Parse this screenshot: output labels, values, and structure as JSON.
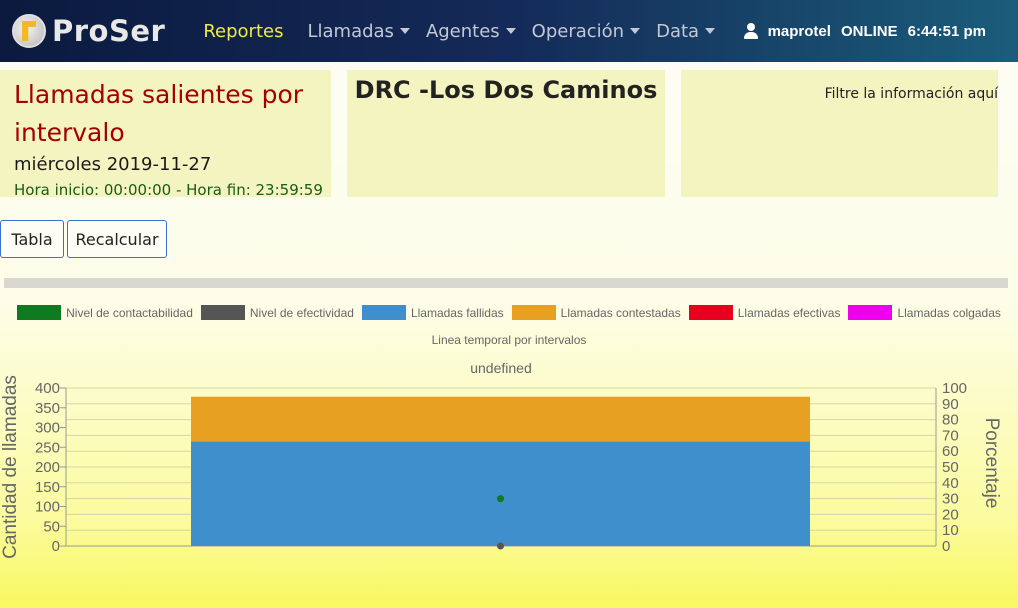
{
  "navbar": {
    "brand": "ProSer",
    "items": [
      {
        "label": "Reportes",
        "active": true,
        "dropdown": false
      },
      {
        "label": "Llamadas",
        "active": false,
        "dropdown": true
      },
      {
        "label": "Agentes",
        "active": false,
        "dropdown": true
      },
      {
        "label": "Operación",
        "active": false,
        "dropdown": true
      },
      {
        "label": "Data",
        "active": false,
        "dropdown": true
      }
    ],
    "user": "maprotel",
    "status": "ONLINE",
    "time": "6:44:51 pm"
  },
  "report": {
    "title": "Llamadas salientes por intervalo",
    "date": "miércoles 2019-11-27",
    "hours": "Hora inicio: 00:00:00 - Hora fin: 23:59:59",
    "site": "DRC -Los Dos Caminos",
    "filter_label": "Filtre la información aquí"
  },
  "buttons": {
    "tabla": "Tabla",
    "recalcular": "Recalcular"
  },
  "colors": {
    "accent_active": "#f1e84a",
    "title_red": "#a40000",
    "card_bg": "#f4f4c0"
  },
  "chart_data": {
    "type": "bar",
    "subtitle": "Linea temporal por intervalos",
    "title": "undefined",
    "legend": [
      {
        "name": "Nivel de contactabilidad",
        "color": "#0f7a1f"
      },
      {
        "name": "Nivel de efectividad",
        "color": "#555555"
      },
      {
        "name": "Llamadas fallidas",
        "color": "#3f8fcc"
      },
      {
        "name": "Llamadas contestadas",
        "color": "#e8a023"
      },
      {
        "name": "Llamadas efectivas",
        "color": "#e8001f"
      },
      {
        "name": "Llamadas colgadas",
        "color": "#ee00ee"
      }
    ],
    "stacked_bars": [
      {
        "name": "Llamadas fallidas",
        "value": 265,
        "color": "#3f8fcc"
      },
      {
        "name": "Llamadas contestadas",
        "value": 113,
        "color": "#e8a023"
      }
    ],
    "points": [
      {
        "name": "Nivel de contactabilidad",
        "value": 30,
        "color": "#0f7a1f"
      },
      {
        "name": "Nivel de efectividad",
        "value": 0,
        "color": "#555555"
      }
    ],
    "ylabel_left": "Cantidad de llamadas",
    "ylabel_right": "Porcentaje",
    "ylim_left": [
      0,
      400
    ],
    "ylim_right": [
      0,
      100
    ],
    "yticks_left": [
      0,
      50,
      100,
      150,
      200,
      250,
      300,
      350,
      400
    ],
    "yticks_right": [
      0,
      10,
      20,
      30,
      40,
      50,
      60,
      70,
      80,
      90,
      100
    ],
    "grid": true,
    "legend_position": "top"
  }
}
